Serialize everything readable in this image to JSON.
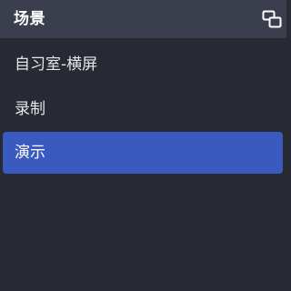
{
  "panel": {
    "title": "场景",
    "dock_icon": "undock-icon"
  },
  "scenes": {
    "items": [
      {
        "label": "自习室-横屏",
        "selected": false
      },
      {
        "label": "录制",
        "selected": false
      },
      {
        "label": "演示",
        "selected": true
      }
    ]
  },
  "colors": {
    "panel_bg": "#272a33",
    "header_bg": "#3b3e4c",
    "selected_bg": "#3a5ac0",
    "text": "#e6e7ec"
  }
}
